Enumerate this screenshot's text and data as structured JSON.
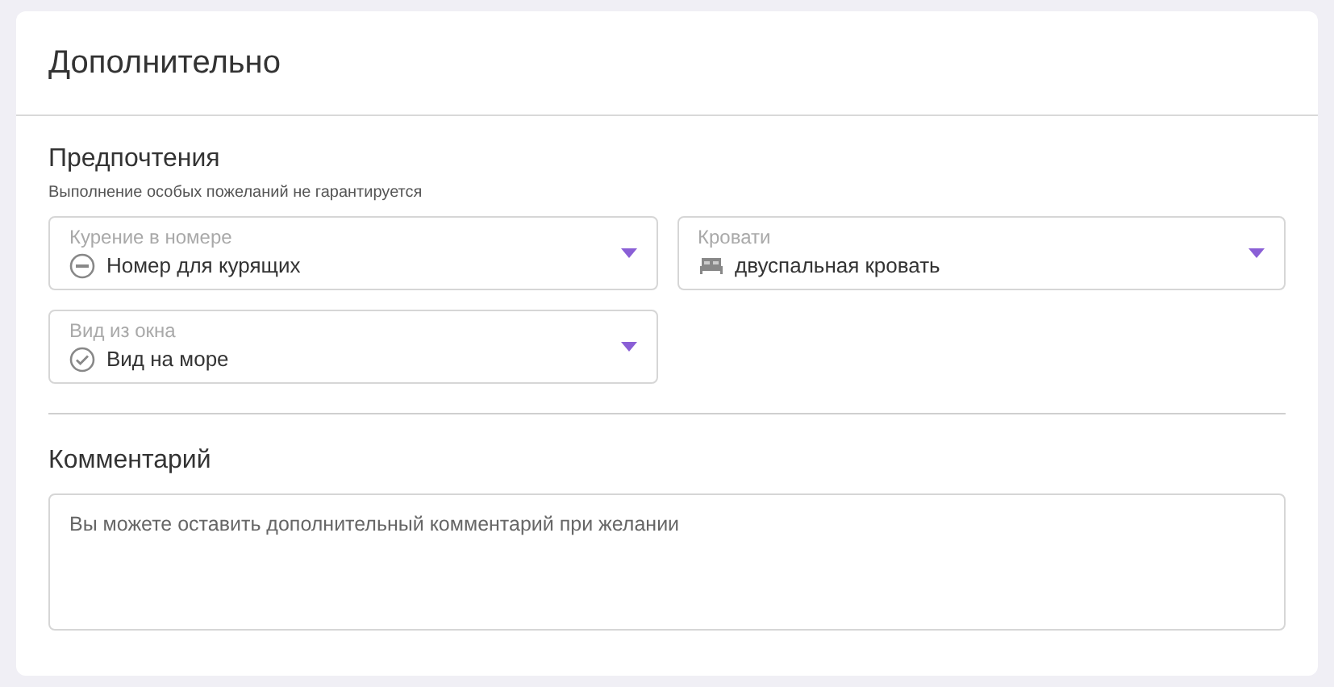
{
  "title": "Дополнительно",
  "preferences": {
    "heading": "Предпочтения",
    "note": "Выполнение особых пожеланий не гарантируется",
    "selects": [
      {
        "label": "Курение в номере",
        "value": "Номер для курящих",
        "kind": "smoking"
      },
      {
        "label": "Кровати",
        "value": "двуспальная кровать",
        "kind": "bed"
      },
      {
        "label": "Вид из окна",
        "value": "Вид на море",
        "kind": "check"
      }
    ]
  },
  "comment": {
    "heading": "Комментарий",
    "placeholder": "Вы можете оставить дополнительный комментарий при желании"
  }
}
